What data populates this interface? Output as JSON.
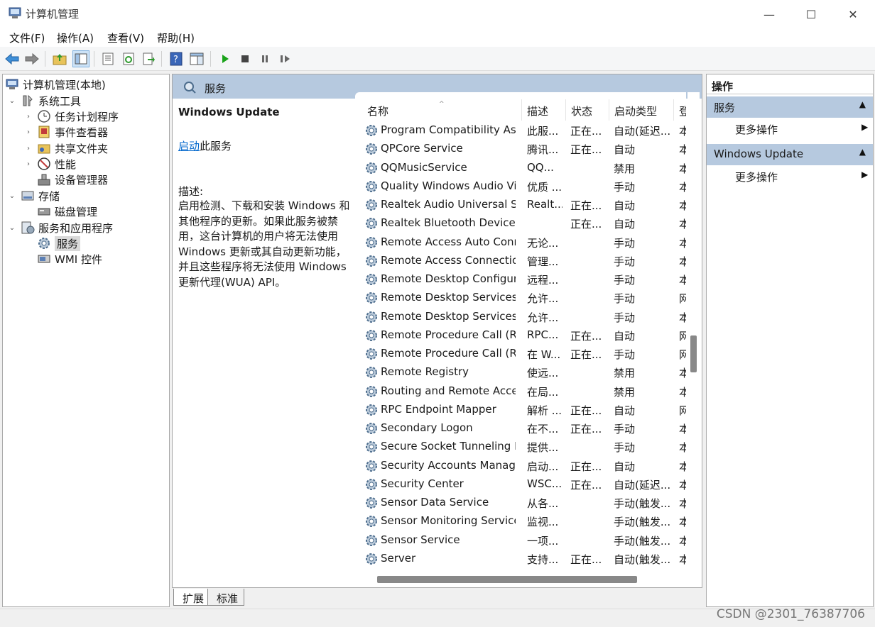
{
  "window": {
    "title": "计算机管理",
    "minimize": "—",
    "maximize": "☐",
    "close": "✕"
  },
  "menu": [
    "文件(F)",
    "操作(A)",
    "查看(V)",
    "帮助(H)"
  ],
  "toolbar": {
    "icons": [
      "back-icon",
      "forward-icon",
      "up-folder-icon",
      "show-hide-tree-icon",
      "properties-icon",
      "refresh-icon",
      "export-icon",
      "help-icon",
      "show-hide-action-icon",
      "start-service-icon",
      "stop-service-icon",
      "pause-service-icon",
      "restart-service-icon"
    ]
  },
  "tree": {
    "root": "计算机管理(本地)",
    "system_tools": "系统工具",
    "task_scheduler": "任务计划程序",
    "event_viewer": "事件查看器",
    "shared_folders": "共享文件夹",
    "performance": "性能",
    "device_manager": "设备管理器",
    "storage": "存储",
    "disk_management": "磁盘管理",
    "services_apps": "服务和应用程序",
    "services": "服务",
    "wmi_control": "WMI 控件"
  },
  "center": {
    "header_title": "服务",
    "selected_service": "Windows Update",
    "start_link": "启动",
    "start_suffix": "此服务",
    "desc_label": "描述:",
    "desc_text": "启用检测、下载和安装 Windows 和其他程序的更新。如果此服务被禁用，这台计算机的用户将无法使用 Windows 更新或其自动更新功能，并且这些程序将无法使用 Windows 更新代理(WUA) API。",
    "columns": {
      "name": "名称",
      "desc": "描述",
      "status": "状态",
      "startup": "启动类型",
      "logon": "登"
    },
    "rows": [
      {
        "name": "Program Compatibility Assi...",
        "desc": "此服...",
        "status": "正在...",
        "startup": "自动(延迟...",
        "logon": "本"
      },
      {
        "name": "QPCore Service",
        "desc": "腾讯...",
        "status": "正在...",
        "startup": "自动",
        "logon": "本"
      },
      {
        "name": "QQMusicService",
        "desc": "QQ...",
        "status": "",
        "startup": "禁用",
        "logon": "本"
      },
      {
        "name": "Quality Windows Audio Vi...",
        "desc": "优质 ...",
        "status": "",
        "startup": "手动",
        "logon": "本"
      },
      {
        "name": "Realtek Audio Universal Se...",
        "desc": "Realt...",
        "status": "正在...",
        "startup": "自动",
        "logon": "本"
      },
      {
        "name": "Realtek Bluetooth Device ...",
        "desc": "",
        "status": "正在...",
        "startup": "自动",
        "logon": "本"
      },
      {
        "name": "Remote Access Auto Conn...",
        "desc": "无论...",
        "status": "",
        "startup": "手动",
        "logon": "本"
      },
      {
        "name": "Remote Access Connectio...",
        "desc": "管理...",
        "status": "",
        "startup": "手动",
        "logon": "本"
      },
      {
        "name": "Remote Desktop Configur...",
        "desc": "远程...",
        "status": "",
        "startup": "手动",
        "logon": "本"
      },
      {
        "name": "Remote Desktop Services",
        "desc": "允许...",
        "status": "",
        "startup": "手动",
        "logon": "网"
      },
      {
        "name": "Remote Desktop Services ...",
        "desc": "允许...",
        "status": "",
        "startup": "手动",
        "logon": "本"
      },
      {
        "name": "Remote Procedure Call (R...",
        "desc": "RPC...",
        "status": "正在...",
        "startup": "自动",
        "logon": "网"
      },
      {
        "name": "Remote Procedure Call (R...",
        "desc": "在 W...",
        "status": "正在...",
        "startup": "手动",
        "logon": "网"
      },
      {
        "name": "Remote Registry",
        "desc": "使远...",
        "status": "",
        "startup": "禁用",
        "logon": "本"
      },
      {
        "name": "Routing and Remote Access",
        "desc": "在局...",
        "status": "",
        "startup": "禁用",
        "logon": "本"
      },
      {
        "name": "RPC Endpoint Mapper",
        "desc": "解析 ...",
        "status": "正在...",
        "startup": "自动",
        "logon": "网"
      },
      {
        "name": "Secondary Logon",
        "desc": "在不...",
        "status": "正在...",
        "startup": "手动",
        "logon": "本"
      },
      {
        "name": "Secure Socket Tunneling P...",
        "desc": "提供...",
        "status": "",
        "startup": "手动",
        "logon": "本"
      },
      {
        "name": "Security Accounts Manager",
        "desc": "启动...",
        "status": "正在...",
        "startup": "自动",
        "logon": "本"
      },
      {
        "name": "Security Center",
        "desc": "WSC...",
        "status": "正在...",
        "startup": "自动(延迟...",
        "logon": "本"
      },
      {
        "name": "Sensor Data Service",
        "desc": "从各...",
        "status": "",
        "startup": "手动(触发...",
        "logon": "本"
      },
      {
        "name": "Sensor Monitoring Service",
        "desc": "监视...",
        "status": "",
        "startup": "手动(触发...",
        "logon": "本"
      },
      {
        "name": "Sensor Service",
        "desc": "一项...",
        "status": "",
        "startup": "手动(触发...",
        "logon": "本"
      },
      {
        "name": "Server",
        "desc": "支持...",
        "status": "正在...",
        "startup": "自动(触发...",
        "logon": "本"
      }
    ]
  },
  "tabs": {
    "extended": "扩展",
    "standard": "标准"
  },
  "actions": {
    "header": "操作",
    "section1": "服务",
    "section1_more": "更多操作",
    "section2": "Windows Update",
    "section2_more": "更多操作"
  },
  "watermark": "CSDN @2301_76387706",
  "colors": {
    "section_bg": "#b6c9df",
    "link": "#0066cc"
  }
}
